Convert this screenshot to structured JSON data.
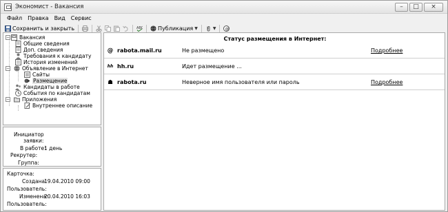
{
  "window": {
    "title": "Экономист - Вакансия",
    "buttons": {
      "minimize": "–",
      "maximize": "□",
      "close": "×"
    }
  },
  "menu": [
    "Файл",
    "Правка",
    "Вид",
    "Сервис"
  ],
  "toolbar": {
    "save_close_label": "Сохранить и закрыть",
    "publish_label": "Публикация",
    "icons": [
      "save-icon",
      "print-icon",
      "cut-icon",
      "copy-icon",
      "paste-icon",
      "undo-icon",
      "spellcheck-icon",
      "globe-icon",
      "paperclip-icon",
      "help-icon"
    ]
  },
  "tree": {
    "root": "Вакансия",
    "items": [
      "Общие сведения",
      "Доп. сведения",
      "Требования к кандидату",
      "История изменений",
      "Объявление в Интернет",
      "Сайты",
      "Размещение",
      "Кандидаты в работе",
      "События по кандидатам",
      "Приложения",
      "Внутреннее описание"
    ]
  },
  "info": {
    "initiator_label": "Инициатор",
    "initiator_label2": "заявки:",
    "in_work_label": "В работе:",
    "in_work_value": "1 день",
    "recruiter_label": "Рекрутер:",
    "group_label": "Группа:"
  },
  "card": {
    "title": "Карточка:",
    "created_label": "Создана:",
    "created_value": "19.04.2010 09:00",
    "user_label": "Пользователь:",
    "modified_label": "Изменена:",
    "modified_value": "20.04.2010 16:03",
    "user2_label": "Пользователь:"
  },
  "status": {
    "header": "Статус размещения в Интернет:",
    "sites": [
      {
        "icon_text": "@",
        "icon": "mail-at-icon",
        "name": "rabota.mail.ru",
        "status": "Не размещено",
        "link": "Подробнее"
      },
      {
        "icon_text": "hh",
        "icon": "hh-logo-icon",
        "name": "hh.ru",
        "status": "Идет размещение ...",
        "link": ""
      },
      {
        "icon_text": "☗",
        "icon": "rabota-logo-icon",
        "name": "rabota.ru",
        "status": "Неверное имя пользователя или пароль",
        "link": "Подробнее"
      }
    ]
  }
}
